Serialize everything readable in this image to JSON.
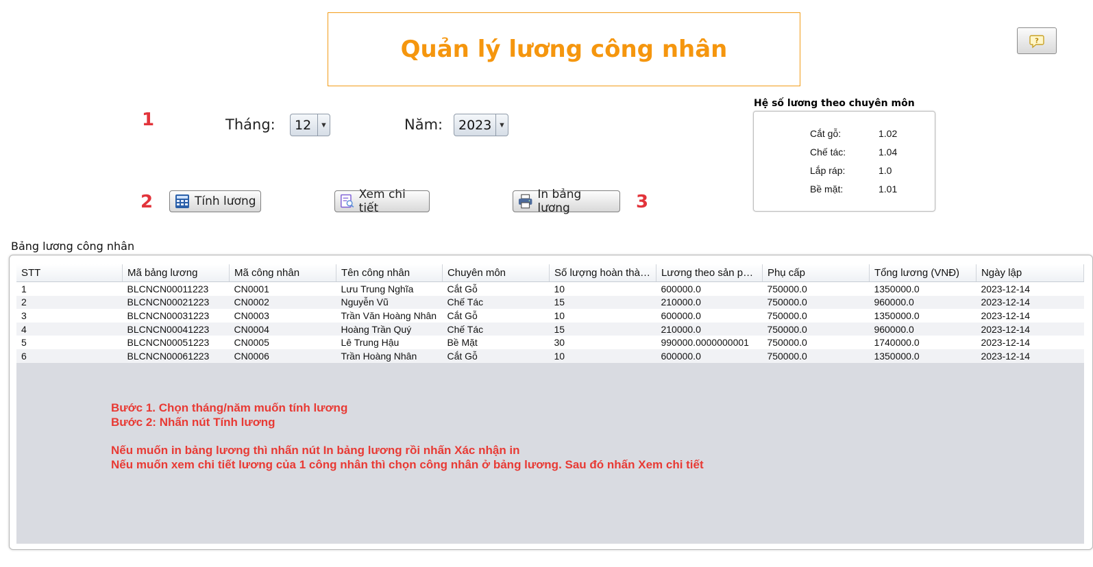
{
  "header": {
    "title": "Quản lý lương công nhân"
  },
  "help_button": {
    "icon": "help-chat-icon"
  },
  "steps": {
    "one": "1",
    "two": "2",
    "three": "3"
  },
  "filters": {
    "month_label": "Tháng:",
    "month_value": "12",
    "year_label": "Năm:",
    "year_value": "2023"
  },
  "actions": {
    "calculate_label": "Tính lương",
    "detail_label": "Xem chi tiết",
    "print_label": "In bảng lương"
  },
  "coefficients": {
    "title": "Hệ số lương theo chuyên môn",
    "items": [
      {
        "label": "Cắt gỗ:",
        "value": "1.02"
      },
      {
        "label": "Chế tác:",
        "value": "1.04"
      },
      {
        "label": "Lắp ráp:",
        "value": "1.0"
      },
      {
        "label": "Bề mặt:",
        "value": "1.01"
      }
    ]
  },
  "table": {
    "section_label": "Bảng lương công nhân",
    "columns": [
      "STT",
      "Mã bảng lương",
      "Mã công nhân",
      "Tên công nhân",
      "Chuyên môn",
      "Số lượng hoàn thành",
      "Lương theo sản phẩ...",
      "Phụ cấp",
      "Tổng lương (VNĐ)",
      "Ngày lập"
    ],
    "rows": [
      [
        "1",
        "BLCNCN00011223",
        "CN0001",
        "Lưu Trung Nghĩa",
        "Cắt Gỗ",
        "10",
        "600000.0",
        "750000.0",
        "1350000.0",
        "2023-12-14"
      ],
      [
        "2",
        "BLCNCN00021223",
        "CN0002",
        "Nguyễn Vũ",
        "Chế Tác",
        "15",
        "210000.0",
        "750000.0",
        "960000.0",
        "2023-12-14"
      ],
      [
        "3",
        "BLCNCN00031223",
        "CN0003",
        "Trần Văn Hoàng Nhân",
        "Cắt Gỗ",
        "10",
        "600000.0",
        "750000.0",
        "1350000.0",
        "2023-12-14"
      ],
      [
        "4",
        "BLCNCN00041223",
        "CN0004",
        "Hoàng Trần Quý",
        "Chế Tác",
        "15",
        "210000.0",
        "750000.0",
        "960000.0",
        "2023-12-14"
      ],
      [
        "5",
        "BLCNCN00051223",
        "CN0005",
        "Lê Trung Hậu",
        "Bề Mặt",
        "30",
        "990000.0000000001",
        "750000.0",
        "1740000.0",
        "2023-12-14"
      ],
      [
        "6",
        "BLCNCN00061223",
        "CN0006",
        "Trần Hoàng Nhân",
        "Cắt Gỗ",
        "10",
        "600000.0",
        "750000.0",
        "1350000.0",
        "2023-12-14"
      ]
    ]
  },
  "instructions": {
    "line1": "Bước 1. Chọn tháng/năm muốn tính lương",
    "line2": "Bước 2: Nhấn nút Tính lương",
    "line3": "Nếu muốn in bảng lương thì nhấn nút In bảng lương rồi nhấn Xác nhận in",
    "line4": "Nếu muốn xem chi tiết lương của 1 công nhân thì chọn công nhân ở bảng lương. Sau đó nhấn Xem chi tiết"
  },
  "colors": {
    "title": "#f5960e",
    "title_border": "#f29b16",
    "step_number": "#e2343b",
    "instruction_text": "#e83a34",
    "table_empty_area": "#d9dbe1"
  }
}
